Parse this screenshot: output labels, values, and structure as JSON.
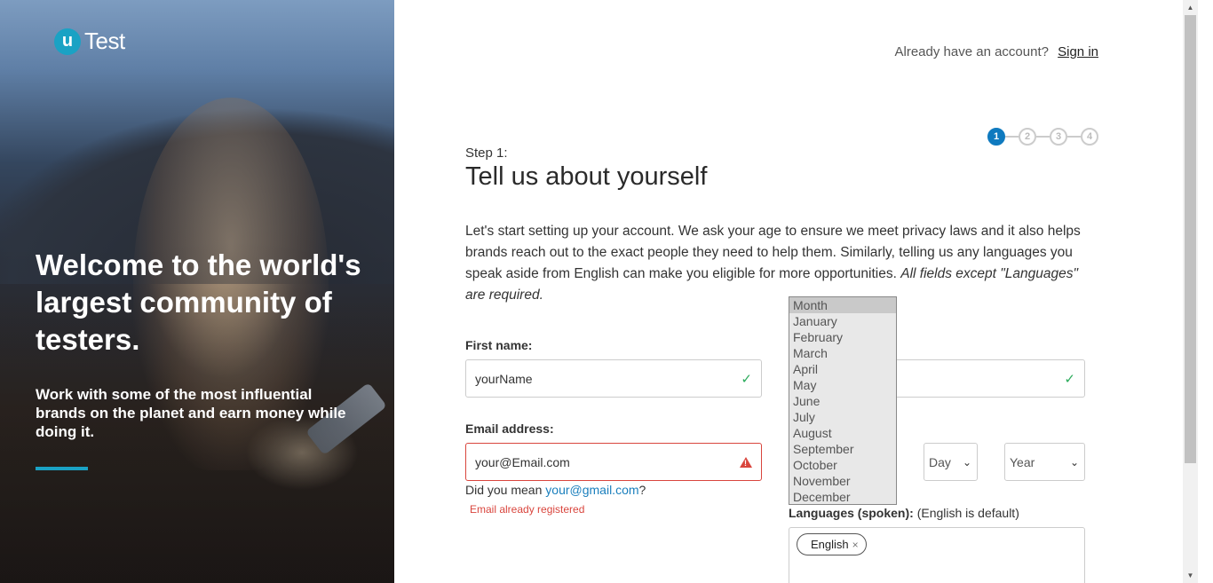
{
  "hero": {
    "logo_mark": "u",
    "logo_text": "Test",
    "title": "Welcome to the world's largest community of testers.",
    "subtitle": "Work with some of the most influential brands on the planet and earn money while doing it.",
    "accent_color": "#1aa2c4"
  },
  "header": {
    "signin_prompt": "Already have an account?",
    "signin_link": "Sign in"
  },
  "stepper": {
    "steps": [
      "1",
      "2",
      "3",
      "4"
    ],
    "active": 1
  },
  "form": {
    "step_label": "Step 1:",
    "title": "Tell us about yourself",
    "intro": "Let's start setting up your account. We ask your age to ensure we meet privacy laws and it also helps brands reach out to the exact people they need to help them. Similarly, telling us any languages you speak aside from English can make you eligible for more opportunities.",
    "intro_emphasis": "All fields except \"Languages\" are required.",
    "first_name": {
      "label": "First name:",
      "value": "yourName",
      "status_icon": "check-icon"
    },
    "last_name": {
      "status_icon": "check-icon"
    },
    "email": {
      "label": "Email address:",
      "value": "your@Email.com",
      "status_icon": "warning-icon",
      "suggest_prefix": "Did you mean",
      "suggest_link": "your@gmail.com",
      "suggest_suffix": "?",
      "error": "Email already registered"
    },
    "dob": {
      "day": "Day",
      "year": "Year",
      "month_options": [
        "Month",
        "January",
        "February",
        "March",
        "April",
        "May",
        "June",
        "July",
        "August",
        "September",
        "October",
        "November",
        "December"
      ],
      "month_selected": "Month"
    },
    "languages": {
      "label": "Languages (spoken):",
      "hint": "(English is default)",
      "chips": [
        "English"
      ],
      "remove_glyph": "×"
    }
  },
  "colors": {
    "primary": "#0f7abf",
    "error": "#d9453d",
    "success": "#2cab5c"
  }
}
